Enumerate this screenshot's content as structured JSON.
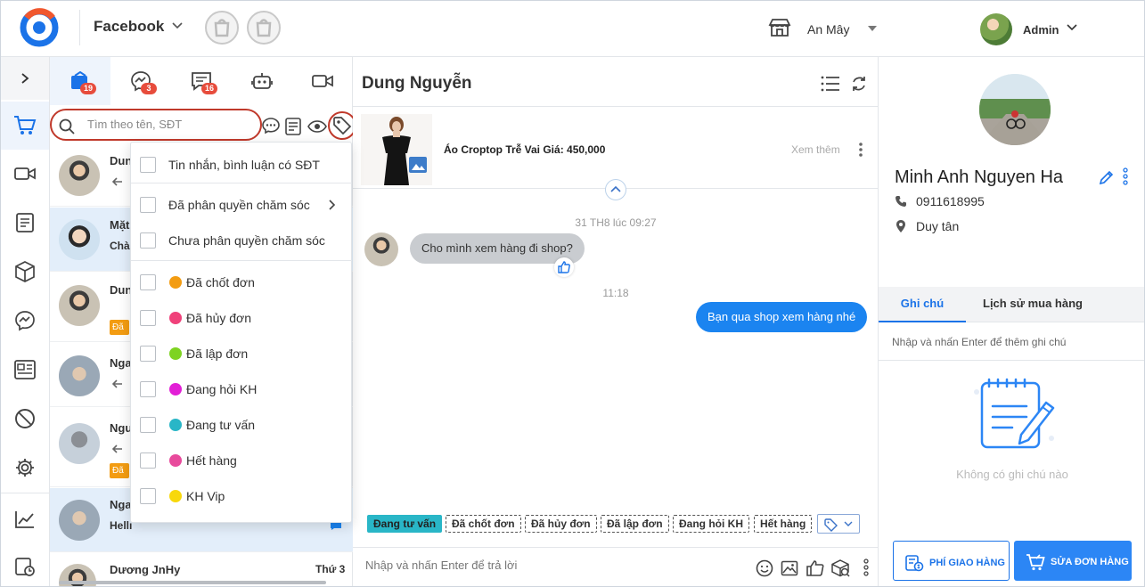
{
  "header": {
    "page_name": "Facebook",
    "store_name": "An Mây",
    "user_name": "Admin"
  },
  "list": {
    "tab_badges": [
      "19",
      "3",
      "16"
    ],
    "search_placeholder": "Tìm theo tên, SĐT",
    "conversations": [
      {
        "name": "Dun",
        "message": "",
        "tag": ""
      },
      {
        "name": "Mặt",
        "message": "Chà",
        "tag": ""
      },
      {
        "name": "Dun",
        "message": "",
        "tag": "Đã"
      },
      {
        "name": "Nga",
        "message": "",
        "tag": ""
      },
      {
        "name": "Ngu",
        "message": "",
        "tag": "Đã"
      },
      {
        "name": "Nga",
        "message": "Hellı",
        "tag": ""
      },
      {
        "name": "Dương JnHy",
        "message": "",
        "time": "Thứ 3"
      }
    ]
  },
  "filter_menu": {
    "items": [
      {
        "label": "Tin nhắn, bình luận có SĐT"
      },
      {
        "label": "Đã phân quyền chăm sóc"
      },
      {
        "label": "Chưa phân quyền chăm sóc"
      }
    ],
    "tags": [
      {
        "label": "Đã chốt đơn",
        "color": "#f39c12"
      },
      {
        "label": "Đã hủy đơn",
        "color": "#f0417a"
      },
      {
        "label": "Đã lập đơn",
        "color": "#7ed321"
      },
      {
        "label": "Đang hỏi KH",
        "color": "#e21fd6"
      },
      {
        "label": "Đang tư vấn",
        "color": "#29b6c7"
      },
      {
        "label": "Hết hàng",
        "color": "#e84a9c"
      },
      {
        "label": "KH Vip",
        "color": "#f8d80b"
      }
    ]
  },
  "chat": {
    "title": "Dung Nguyễn",
    "product_name": "Áo Croptop Trễ Vai Giá: 450,000",
    "product_more": "Xem thêm",
    "timestamp_1": "31 TH8 lúc 09:27",
    "incoming_message": "Cho mình xem hàng đi shop?",
    "timestamp_2": "11:18",
    "outgoing_message": "Bạn qua shop xem hàng nhé",
    "tag_chips": [
      "Đang tư vấn",
      "Đã chốt đơn",
      "Đã hủy đơn",
      "Đã lập đơn",
      "Đang hỏi KH",
      "Hết hàng"
    ],
    "reply_placeholder": "Nhập và nhấn Enter để trả lời"
  },
  "customer": {
    "name": "Minh Anh Nguyen Ha",
    "phone": "0911618995",
    "address": "Duy tân",
    "tab_notes": "Ghi chú",
    "tab_history": "Lịch sử mua hàng",
    "note_placeholder": "Nhập và nhấn Enter để thêm ghi chú",
    "empty_notes": "Không có ghi chú nào",
    "shipping_button": "PHÍ GIAO HÀNG",
    "edit_order_button": "SỬA ĐƠN HÀNG"
  },
  "colors": {
    "accent": "#1b73e8",
    "outgoing_bubble": "#1b84f0",
    "highlight_outline": "#c0392b",
    "badge": "#e74c3c"
  }
}
